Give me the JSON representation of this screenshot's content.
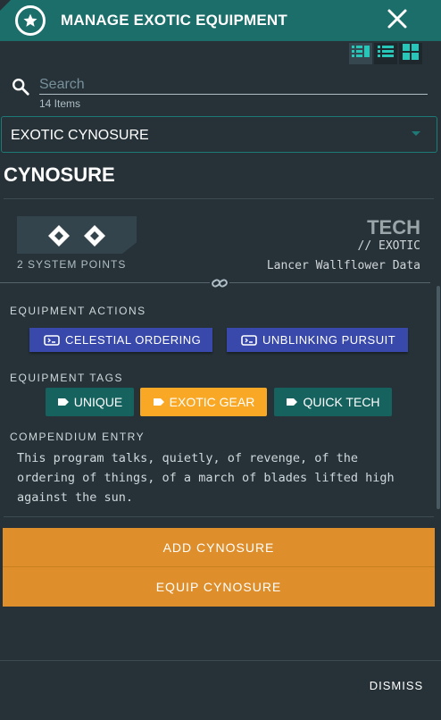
{
  "dialog": {
    "title": "MANAGE EXOTIC EQUIPMENT",
    "title_icon": "star-icon",
    "close_icon": "close-icon"
  },
  "view_toggles": [
    {
      "icon": "list-detail-icon",
      "active": true
    },
    {
      "icon": "list-icon",
      "active": false
    },
    {
      "icon": "grid-icon",
      "active": false
    }
  ],
  "search": {
    "placeholder": "Search",
    "value": "",
    "count_label": "14 Items"
  },
  "category_select": {
    "selected": "EXOTIC CYNOSURE"
  },
  "item": {
    "name": "CYNOSURE",
    "system_points_label": "2 SYSTEM POINTS",
    "system_points": 2,
    "type": "TECH",
    "rarity": "// EXOTIC",
    "source": "Lancer Wallflower Data",
    "actions_label": "EQUIPMENT ACTIONS",
    "actions": [
      {
        "label": "CELESTIAL ORDERING",
        "icon": "tech-action-icon"
      },
      {
        "label": "UNBLINKING PURSUIT",
        "icon": "tech-action-icon"
      }
    ],
    "tags_label": "EQUIPMENT TAGS",
    "tags": [
      {
        "label": "UNIQUE",
        "color": "#16625e",
        "icon": "tag-icon"
      },
      {
        "label": "EXOTIC GEAR",
        "color": "#f9a825",
        "icon": "tag-icon"
      },
      {
        "label": "QUICK TECH",
        "color": "#16625e",
        "icon": "tag-icon"
      }
    ],
    "compendium_label": "COMPENDIUM ENTRY",
    "compendium_text": "This program talks, quietly, of revenge, of the ordering of things, of a march of blades lifted high against the sun."
  },
  "buttons": {
    "add": "ADD CYNOSURE",
    "equip": "EQUIP CYNOSURE",
    "dismiss": "DISMISS"
  },
  "colors": {
    "background": "#263238",
    "title_bar": "#1b6e6a",
    "action_button": "#3949ab",
    "primary_button": "#de8f2c",
    "select_border": "#1e7a76"
  }
}
